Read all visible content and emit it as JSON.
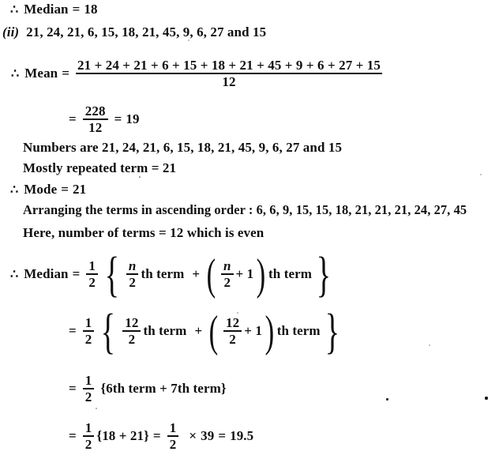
{
  "document": {
    "type": "handwritten-textbook-solution-scan",
    "subject": "statistics-mean-median-mode",
    "symbols": {
      "therefore": "∴",
      "equals": "=",
      "plus": "+",
      "times": "×"
    },
    "lines": [
      {
        "id": "median-result-prev",
        "label": "Median",
        "text": "∴  Median = 18",
        "value": "18"
      },
      {
        "id": "part-ii-data",
        "marker": "(ii)",
        "text": "21, 24, 21, 6, 15, 18, 21, 45, 9, 6, 27 and 15",
        "data": [
          21,
          24,
          21,
          6,
          15,
          18,
          21,
          45,
          9,
          6,
          27,
          15
        ]
      },
      {
        "id": "mean-formula",
        "label": "Mean",
        "numerator": "21 + 24 + 21 + 6 + 15 + 18 + 21 + 45 + 9 + 6 + 27 + 15",
        "denominator": "12"
      },
      {
        "id": "mean-result",
        "numerator": "228",
        "denominator": "12",
        "result": "19"
      },
      {
        "id": "numbers-are",
        "text": "Numbers are 21, 24, 21, 6, 15, 18, 21, 45, 9, 6, 27 and 15"
      },
      {
        "id": "mostly-repeated",
        "text": "Mostly repeated term = 21",
        "value": "21"
      },
      {
        "id": "mode-result",
        "label": "Mode",
        "text": "∴  Mode = 21",
        "value": "21"
      },
      {
        "id": "ascending-order",
        "text": "Arranging the terms in ascending order : 6, 6, 9, 15, 15, 18, 21, 21, 21, 24, 27, 45",
        "sorted": [
          6,
          6,
          9,
          15,
          15,
          18,
          21,
          21,
          21,
          24,
          27,
          45
        ]
      },
      {
        "id": "number-of-terms",
        "text": "Here, number of terms = 12 which is even",
        "n": "12"
      },
      {
        "id": "median-general-formula",
        "label": "Median",
        "half_num": "1",
        "half_den": "2",
        "term1_num": "n",
        "term1_den": "2",
        "term1_suffix": "th term",
        "operator": "+",
        "term2_num": "n",
        "term2_den": "2",
        "term2_add": "+ 1",
        "term2_suffix": "th term"
      },
      {
        "id": "median-substituted",
        "half_num": "1",
        "half_den": "2",
        "term1_num": "12",
        "term1_den": "2",
        "term1_suffix": "th term",
        "operator": "+",
        "term2_num": "12",
        "term2_den": "2",
        "term2_add": "+ 1",
        "term2_suffix": "th term"
      },
      {
        "id": "median-terms",
        "half_num": "1",
        "half_den": "2",
        "text": "{6th term + 7th term}"
      },
      {
        "id": "median-final",
        "half_num": "1",
        "half_den": "2",
        "bracket": "{18 + 21}",
        "half2_num": "1",
        "half2_den": "2",
        "times_value": "39",
        "result": "19.5"
      }
    ]
  }
}
